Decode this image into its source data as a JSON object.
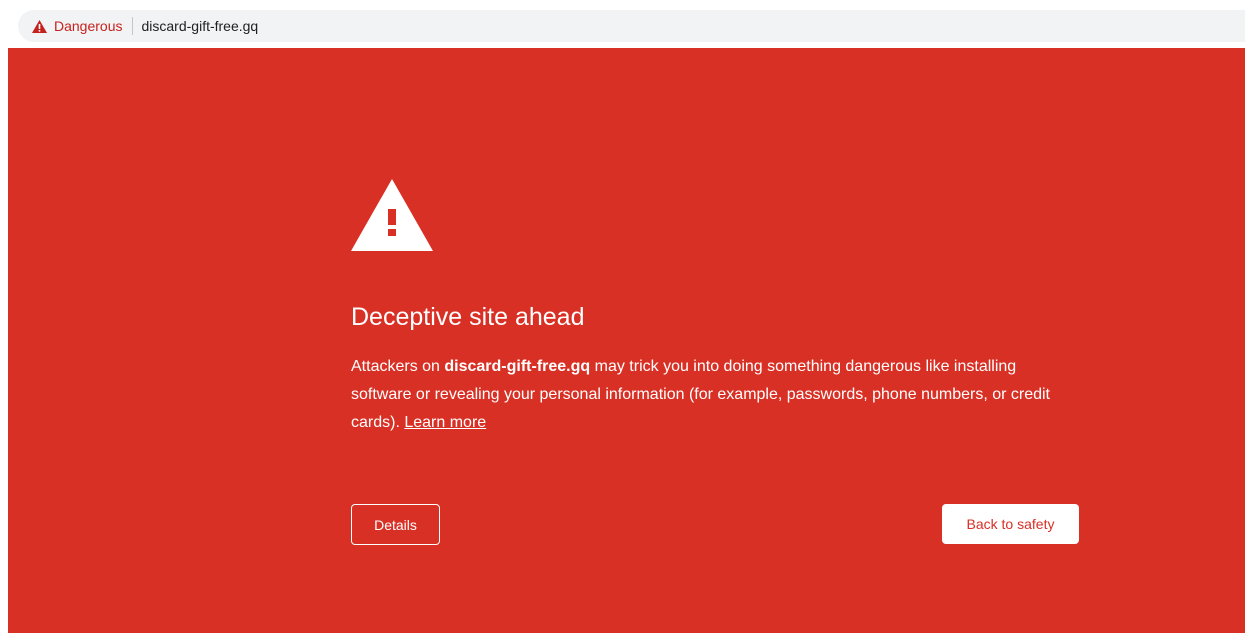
{
  "address_bar": {
    "security_icon": "warning-triangle-icon",
    "security_label": "Dangerous",
    "url": "discard-gift-free.gq"
  },
  "interstitial": {
    "icon": "warning-triangle-icon",
    "title": "Deceptive site ahead",
    "body_prefix": "Attackers on ",
    "body_site": "discard-gift-free.gq",
    "body_suffix": " may trick you into doing something dangerous like installing software or revealing your personal information (for example, passwords, phone numbers, or credit cards). ",
    "learn_more": "Learn more",
    "details_button": "Details",
    "back_button": "Back to safety"
  },
  "colors": {
    "danger_red": "#d93025",
    "address_bar_bg": "#f1f3f4",
    "danger_text": "#c5221f"
  }
}
